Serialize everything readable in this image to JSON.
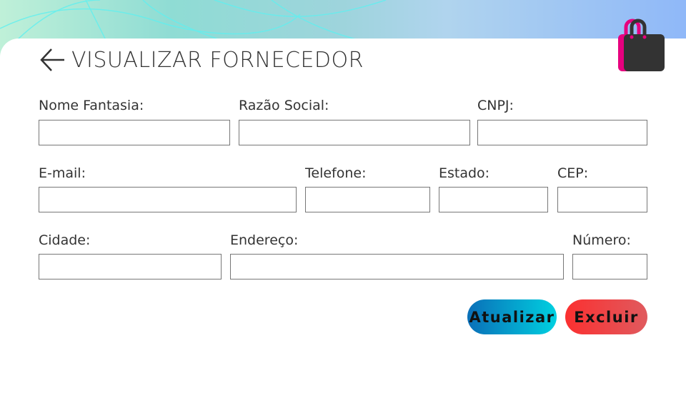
{
  "header": {
    "title": "VISUALIZAR FORNECEDOR",
    "back_icon": "arrow-left-icon",
    "logo_icon": "shopping-bag-icon"
  },
  "fields": [
    {
      "label": "Nome Fantasia:",
      "value": ""
    },
    {
      "label": "Razão Social:",
      "value": ""
    },
    {
      "label": "CNPJ:",
      "value": ""
    },
    {
      "label": "E-mail:",
      "value": ""
    },
    {
      "label": "Telefone:",
      "value": ""
    },
    {
      "label": "Estado:",
      "value": ""
    },
    {
      "label": "CEP:",
      "value": ""
    },
    {
      "label": "Cidade:",
      "value": ""
    },
    {
      "label": "Endereço:",
      "value": ""
    },
    {
      "label": "Número:",
      "value": ""
    }
  ],
  "buttons": {
    "update": "Atualizar",
    "delete": "Excluir"
  },
  "colors": {
    "update_gradient": [
      "#0a6fb8",
      "#00d0e0"
    ],
    "delete_gradient": [
      "#fb3030",
      "#e05a5e"
    ],
    "bag_pink": "#e6007e",
    "bag_dark": "#333333"
  }
}
